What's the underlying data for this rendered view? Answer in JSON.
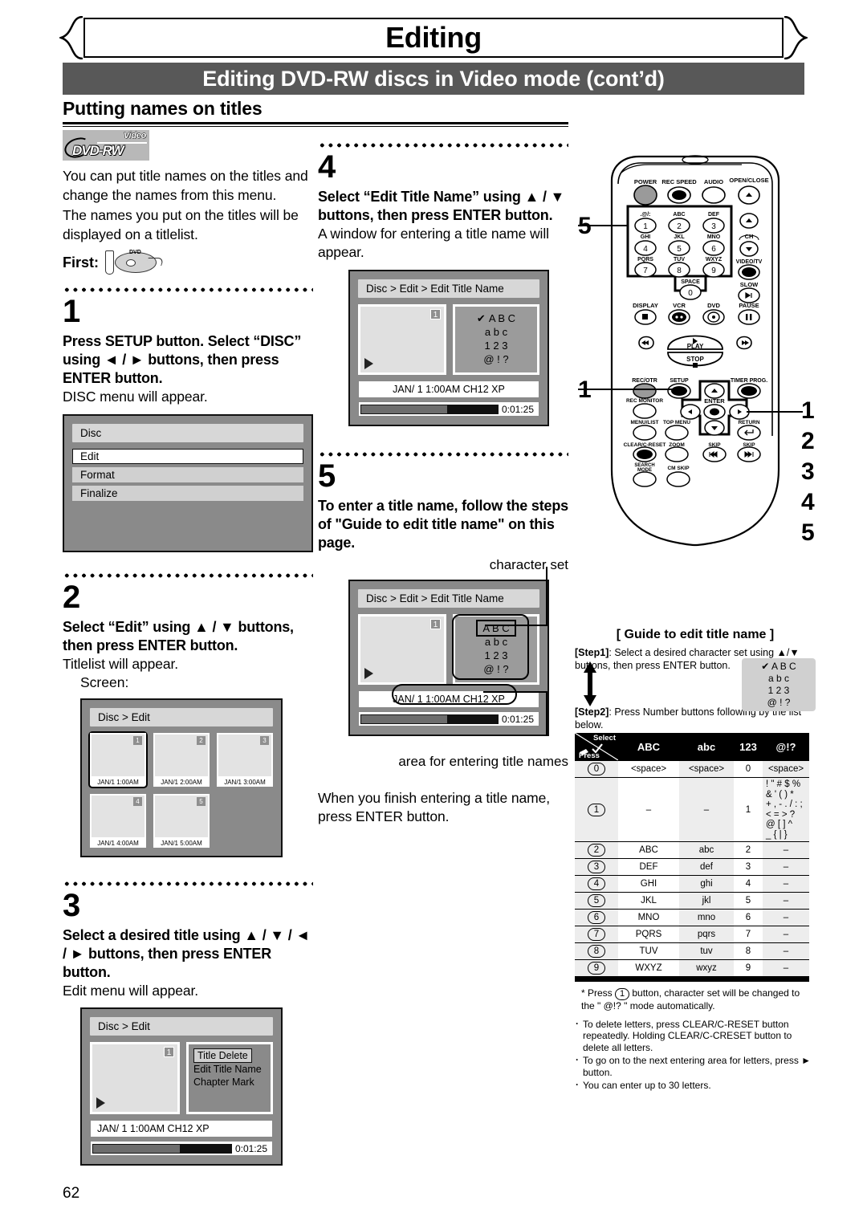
{
  "header": {
    "banner_title": "Editing",
    "subhead": "Editing DVD-RW discs in Video mode (cont’d)",
    "section_title": "Putting names on titles"
  },
  "logo": {
    "video": "Video",
    "format": "DVD-RW"
  },
  "intro": {
    "p1": "You can put title names on the titles and change the names from this menu.",
    "p2": "The names you put on the titles will be displayed on a titlelist.",
    "first_label": "First:",
    "first_icon": "disc-insert-icon"
  },
  "steps": {
    "s1": {
      "number": "1",
      "bold": "Press SETUP button. Select “DISC” using ◄ / ► buttons, then press ENTER button.",
      "plain": "DISC menu will appear.",
      "screen": {
        "title": "Disc",
        "items": [
          "Edit",
          "Format",
          "Finalize"
        ],
        "selected": "Edit"
      }
    },
    "s2": {
      "number": "2",
      "bold": "Select “Edit” using ▲ / ▼ buttons, then press ENTER button.",
      "plain": "Titlelist will appear.",
      "screen_label": "Screen:",
      "screen": {
        "title": "Disc > Edit",
        "titles": [
          {
            "num": "1",
            "label": "JAN/1  1:00AM",
            "selected": true
          },
          {
            "num": "2",
            "label": "JAN/1  2:00AM",
            "selected": false
          },
          {
            "num": "3",
            "label": "JAN/1  3:00AM",
            "selected": false
          },
          {
            "num": "4",
            "label": "JAN/1  4:00AM",
            "selected": false
          },
          {
            "num": "5",
            "label": "JAN/1  5:00AM",
            "selected": false
          }
        ]
      }
    },
    "s3": {
      "number": "3",
      "bold": "Select a desired title using ▲ / ▼ / ◄ / ► buttons, then press ENTER button.",
      "plain": "Edit menu will appear.",
      "screen": {
        "title": "Disc > Edit",
        "thumb_num": "1",
        "options": [
          "Title Delete",
          "Edit Title Name",
          "Chapter Mark"
        ],
        "selected": "Title Delete",
        "info": "JAN/ 1  1:00AM  CH12    XP",
        "timecode": "0:01:25"
      }
    },
    "s4": {
      "number": "4",
      "bold": "Select “Edit Title Name” using ▲ / ▼ buttons, then press ENTER button.",
      "plain": "A window for entering a title name will appear.",
      "screen": {
        "title": "Disc > Edit > Edit Title Name",
        "thumb_num": "1",
        "charset": [
          "A B C",
          "a b c",
          "1 2 3",
          "@ ! ?"
        ],
        "check_on": "A B C",
        "info": "JAN/ 1  1:00AM  CH12  XP",
        "timecode": "0:01:25"
      }
    },
    "s5": {
      "number": "5",
      "bold": "To enter a title name, follow the steps of \"Guide to edit title name\" on this page.",
      "callout_top": "character set",
      "callout_bottom": "area for entering title names",
      "screen": {
        "title": "Disc > Edit > Edit Title Name",
        "thumb_num": "1",
        "charset": [
          "A B C",
          "a b c",
          "1 2 3",
          "@ ! ?"
        ],
        "selected": "A B C",
        "info": "JAN/ 1  1:00AM  CH12  XP",
        "timecode": "0:01:25"
      },
      "closing": "When you finish entering a title name, press ENTER button."
    }
  },
  "remote": {
    "labels": {
      "power": "POWER",
      "rec_speed": "REC SPEED",
      "audio": "AUDIO",
      "open_close": "OPEN/CLOSE",
      "key1_sub": ".@/:",
      "key2_sub": "ABC",
      "key3_sub": "DEF",
      "key4_sub": "GHI",
      "key5_sub": "JKL",
      "key6_sub": "MNO",
      "key7_sub": "PQRS",
      "key8_sub": "TUV",
      "key9_sub": "WXYZ",
      "key0_sub": "SPACE",
      "ch": "CH",
      "video_tv": "VIDEO/TV",
      "slow": "SLOW",
      "display": "DISPLAY",
      "vcr": "VCR",
      "dvd": "DVD",
      "pause": "PAUSE",
      "play": "PLAY",
      "stop": "STOP",
      "rec_otr": "REC/OTR",
      "setup": "SETUP",
      "timer_prog": "TIMER PROG.",
      "rec_monitor": "REC MONITOR",
      "enter": "ENTER",
      "menu_list": "MENU/LIST",
      "top_menu": "TOP MENU",
      "return": "RETURN",
      "clear_creset": "CLEAR/C-RESET",
      "zoom": "ZOOM",
      "skip_back": "SKIP",
      "skip_fwd": "SKIP",
      "search_mode": "SEARCH MODE",
      "cm_skip": "CM SKIP",
      "numbers": [
        "1",
        "2",
        "3",
        "4",
        "5",
        "6",
        "7",
        "8",
        "9",
        "0"
      ]
    },
    "markers": {
      "left_top": "5",
      "left_bottom": "1",
      "right_stack": [
        "1",
        "2",
        "3",
        "4",
        "5"
      ]
    }
  },
  "guide": {
    "title": "[ Guide to edit title name ]",
    "step1_label": "[Step1]",
    "step1_text": ": Select a desired character set using ▲/▼ buttons, then press ENTER button.",
    "step2_label": "[Step2]",
    "step2_text": ": Press Number buttons following by the list below.",
    "mini_charset": [
      "A B C",
      "a b c",
      "1 2 3",
      "@ ! ?"
    ],
    "mini_check_on": "A B C",
    "select_label": "Select",
    "press_label": "Press",
    "columns": [
      "ABC",
      "abc",
      "123",
      "@!?"
    ],
    "rows": [
      {
        "key": "0",
        "abc": "<space>",
        "lower": "<space>",
        "num": "0",
        "sym": "<space>"
      },
      {
        "key": "1",
        "abc": "–",
        "lower": "–",
        "num": "1",
        "sym": "! \" # $ %\n& ' ( ) *\n+ , - . / : ;\n< = > ?\n@ [ ] ^\n_ { | }"
      },
      {
        "key": "2",
        "abc": "ABC",
        "lower": "abc",
        "num": "2",
        "sym": "–"
      },
      {
        "key": "3",
        "abc": "DEF",
        "lower": "def",
        "num": "3",
        "sym": "–"
      },
      {
        "key": "4",
        "abc": "GHI",
        "lower": "ghi",
        "num": "4",
        "sym": "–"
      },
      {
        "key": "5",
        "abc": "JKL",
        "lower": "jkl",
        "num": "5",
        "sym": "–"
      },
      {
        "key": "6",
        "abc": "MNO",
        "lower": "mno",
        "num": "6",
        "sym": "–"
      },
      {
        "key": "7",
        "abc": "PQRS",
        "lower": "pqrs",
        "num": "7",
        "sym": "–"
      },
      {
        "key": "8",
        "abc": "TUV",
        "lower": "tuv",
        "num": "8",
        "sym": "–"
      },
      {
        "key": "9",
        "abc": "WXYZ",
        "lower": "wxyz",
        "num": "9",
        "sym": "–"
      }
    ],
    "note_star_pre": "* Press",
    "note_star_key": "1",
    "note_star_post": "button, character set will be changed to the \" @!? \" mode automatically.",
    "bullets": [
      "To delete letters, press CLEAR/C-RESET button repeatedly. Holding CLEAR/C-CRESET button to delete all letters.",
      "To go on to the next entering area for letters, press ► button.",
      "You can enter up to 30 letters."
    ]
  },
  "page_number": "62"
}
